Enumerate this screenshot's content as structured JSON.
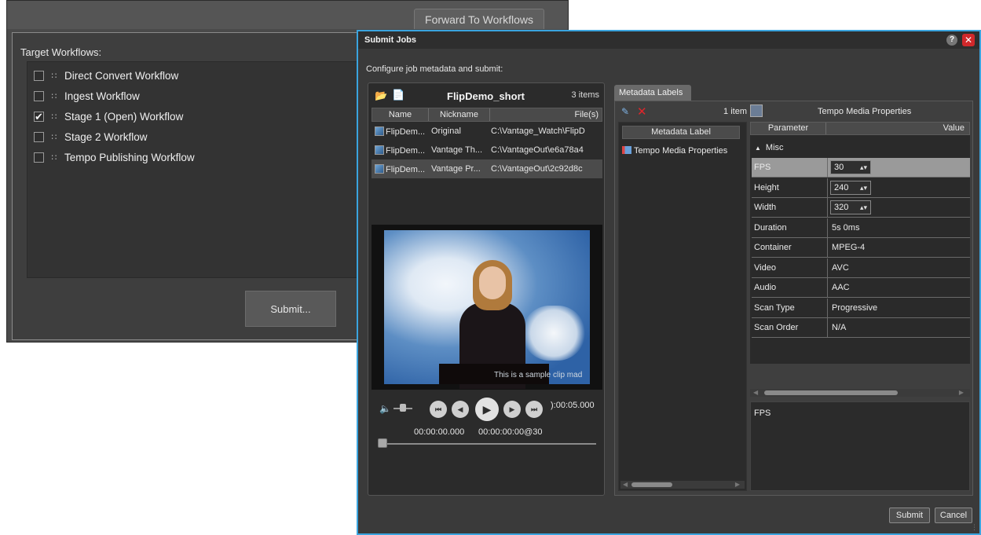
{
  "background_window": {
    "tab_label": "Forward To Workflows",
    "target_label": "Target Workflows:",
    "workflows": [
      {
        "label": "Direct Convert Workflow",
        "checked": false
      },
      {
        "label": "Ingest Workflow",
        "checked": false
      },
      {
        "label": "Stage 1 (Open) Workflow",
        "checked": true
      },
      {
        "label": "Stage 2 Workflow",
        "checked": false
      },
      {
        "label": "Tempo Publishing Workflow",
        "checked": false
      }
    ],
    "submit_label": "Submit..."
  },
  "dialog": {
    "title": "Submit Jobs",
    "help_label": "?",
    "close_label": "✕",
    "subtitle": "Configure job metadata and submit:",
    "file_panel": {
      "title": "FlipDemo_short",
      "count": "3 items",
      "columns": [
        "Name",
        "Nickname",
        "File(s)"
      ],
      "rows": [
        {
          "name": "FlipDem...",
          "nickname": "Original",
          "file": "C:\\Vantage_Watch\\FlipD"
        },
        {
          "name": "FlipDem...",
          "nickname": "Vantage Th...",
          "file": "C:\\VantageOut\\e6a78a4"
        },
        {
          "name": "FlipDem...",
          "nickname": "Vantage Pr...",
          "file": "C:\\VantageOut\\2c92d8c"
        }
      ],
      "selected_row": 2
    },
    "video": {
      "caption": "This is a sample clip mad",
      "time_end": "):00:05.000",
      "time_current": "00:00:00.000",
      "time_frame": "00:00:00:00@30",
      "playback_progress": 0
    },
    "metadata_tab": "Metadata Labels",
    "metadata_labels": {
      "count": "1 item",
      "column": "Metadata Label",
      "items": [
        "Tempo Media Properties"
      ]
    },
    "properties": {
      "title": "Tempo Media Properties",
      "col_parameter": "Parameter",
      "col_value": "Value",
      "group": "Misc",
      "group_toggle": "▲",
      "rows": [
        {
          "name": "FPS",
          "value": "30",
          "spinner": true
        },
        {
          "name": "Height",
          "value": "240",
          "spinner": true
        },
        {
          "name": "Width",
          "value": "320",
          "spinner": true
        },
        {
          "name": "Duration",
          "value": "5s 0ms",
          "spinner": false
        },
        {
          "name": "Container",
          "value": "MPEG-4",
          "spinner": false
        },
        {
          "name": "Video",
          "value": "AVC",
          "spinner": false
        },
        {
          "name": "Audio",
          "value": "AAC",
          "spinner": false
        },
        {
          "name": "Scan Type",
          "value": "Progressive",
          "spinner": false
        },
        {
          "name": "Scan Order",
          "value": "N/A",
          "spinner": false
        }
      ],
      "selected_row": 0,
      "description": "FPS"
    },
    "submit_label": "Submit",
    "cancel_label": "Cancel"
  },
  "colors": {
    "dialog_border": "#3aa4df",
    "close_button": "#d0282b",
    "folder_icon": "#f0b64a"
  }
}
